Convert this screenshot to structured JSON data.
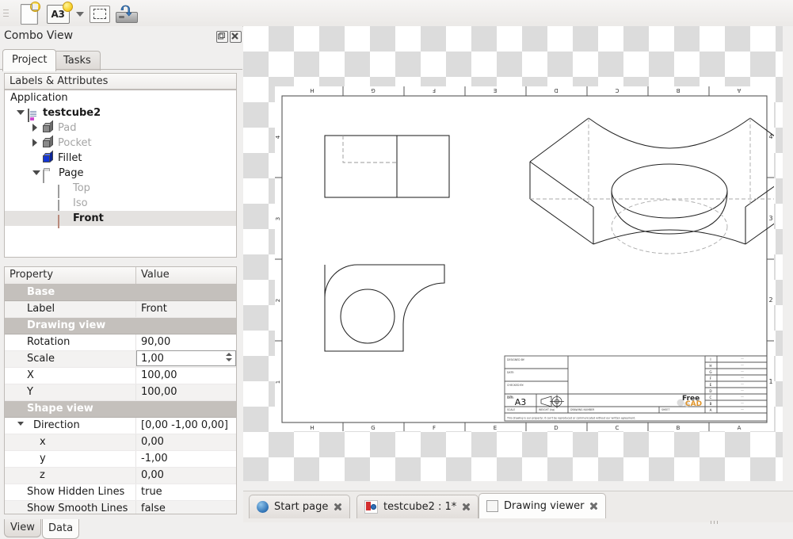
{
  "toolbar": {
    "new_page_label": "New page",
    "template_label": "A3",
    "dropdown_label": "",
    "insert_view_label": "Insert view",
    "export_label": "Export page"
  },
  "dock": {
    "title": "Combo View",
    "float_label": "Float",
    "close_label": "Close",
    "tabs": [
      {
        "label": "Project",
        "active": true
      },
      {
        "label": "Tasks",
        "active": false
      }
    ],
    "section_header": "Labels & Attributes"
  },
  "tree": {
    "root": "Application",
    "items": [
      {
        "label": "testcube2",
        "icon": "document-icon",
        "depth": 1,
        "twisty": "open",
        "bold": true,
        "dim": false
      },
      {
        "label": "Pad",
        "icon": "solid-cube-icon",
        "depth": 2,
        "twisty": "closed",
        "bold": false,
        "dim": true
      },
      {
        "label": "Pocket",
        "icon": "solid-cube-icon",
        "depth": 2,
        "twisty": "closed",
        "bold": false,
        "dim": true
      },
      {
        "label": "Fillet",
        "icon": "blue-cube-icon",
        "depth": 2,
        "twisty": "none",
        "bold": false,
        "dim": false
      },
      {
        "label": "Page",
        "icon": "folder-icon",
        "depth": 2,
        "twisty": "open",
        "bold": false,
        "dim": false
      },
      {
        "label": "Top",
        "icon": "view-checkbox-icon",
        "depth": 3,
        "twisty": "none",
        "bold": false,
        "dim": true
      },
      {
        "label": "Iso",
        "icon": "view-checkbox-icon",
        "depth": 3,
        "twisty": "none",
        "bold": false,
        "dim": true
      },
      {
        "label": "Front",
        "icon": "view-page-icon",
        "depth": 3,
        "twisty": "none",
        "bold": true,
        "dim": false,
        "selected": true
      }
    ]
  },
  "properties": {
    "columns": [
      "Property",
      "Value"
    ],
    "rows": [
      {
        "kind": "group",
        "name": "Base",
        "value": ""
      },
      {
        "kind": "item",
        "name": "Label",
        "value": "Front"
      },
      {
        "kind": "group",
        "name": "Drawing view",
        "value": ""
      },
      {
        "kind": "item",
        "name": "Rotation",
        "value": "90,00"
      },
      {
        "kind": "editing",
        "name": "Scale",
        "value": "1,00"
      },
      {
        "kind": "item",
        "name": "X",
        "value": "100,00"
      },
      {
        "kind": "item",
        "name": "Y",
        "value": "100,00"
      },
      {
        "kind": "group",
        "name": "Shape view",
        "value": ""
      },
      {
        "kind": "expandable",
        "name": "Direction",
        "value": "[0,00 -1,00 0,00]"
      },
      {
        "kind": "child",
        "name": "x",
        "value": "0,00"
      },
      {
        "kind": "child",
        "name": "y",
        "value": "-1,00"
      },
      {
        "kind": "child",
        "name": "z",
        "value": "0,00"
      },
      {
        "kind": "item",
        "name": "Show Hidden Lines",
        "value": "true"
      },
      {
        "kind": "item",
        "name": "Show Smooth Lines",
        "value": "false"
      }
    ]
  },
  "view_tabs": [
    {
      "label": "View",
      "active": false
    },
    {
      "label": "Data",
      "active": true
    }
  ],
  "window_tabs": [
    {
      "label": "Start page",
      "icon": "globe-icon",
      "active": false
    },
    {
      "label": "testcube2 : 1*",
      "icon": "freecad-doc-icon",
      "active": false
    },
    {
      "label": "Drawing viewer",
      "icon": "drawing-page-icon",
      "active": true
    }
  ],
  "drawing": {
    "sheet_size": "A3",
    "column_marks": [
      "H",
      "G",
      "F",
      "E",
      "D",
      "C",
      "B",
      "A"
    ],
    "row_marks": [
      "4",
      "3",
      "2",
      "1"
    ],
    "title_block": {
      "designed_by_label": "DESIGNED BY:",
      "designed_by_date_label": "DATE:",
      "checked_by_label": "CHECKED BY:",
      "checked_by_date_label": "DATE:",
      "size_label": "SIZE",
      "size_value": "A3",
      "scale_label": "SCALE",
      "weight_label": "WEIGHT (kg)",
      "drawing_number_label": "DRAWING NUMBER",
      "sheet_label": "SHEET",
      "logo_line1": "Free",
      "logo_line2": "CAD",
      "footer_note": "This drawing is our property; it can't be reproduced or communicated without our written agreement."
    },
    "revision_rows": [
      "I",
      "H",
      "G",
      "F",
      "E",
      "D",
      "C",
      "B",
      "A"
    ],
    "revision_placeholder": "—",
    "views": [
      {
        "name": "Top",
        "type": "orthographic-rectangle"
      },
      {
        "name": "Iso",
        "type": "isometric-block"
      },
      {
        "name": "Front",
        "type": "profile-with-hole"
      }
    ]
  },
  "colors": {
    "window_bg": "#f0efee",
    "panel_bg": "#ffffff",
    "group_row": "#c4c0bc",
    "selection": "#e4e2e0",
    "checker_light": "#ffffff",
    "checker_dark": "#dcdcdc",
    "line": "#333333",
    "logo_orange": "#e0952b"
  }
}
